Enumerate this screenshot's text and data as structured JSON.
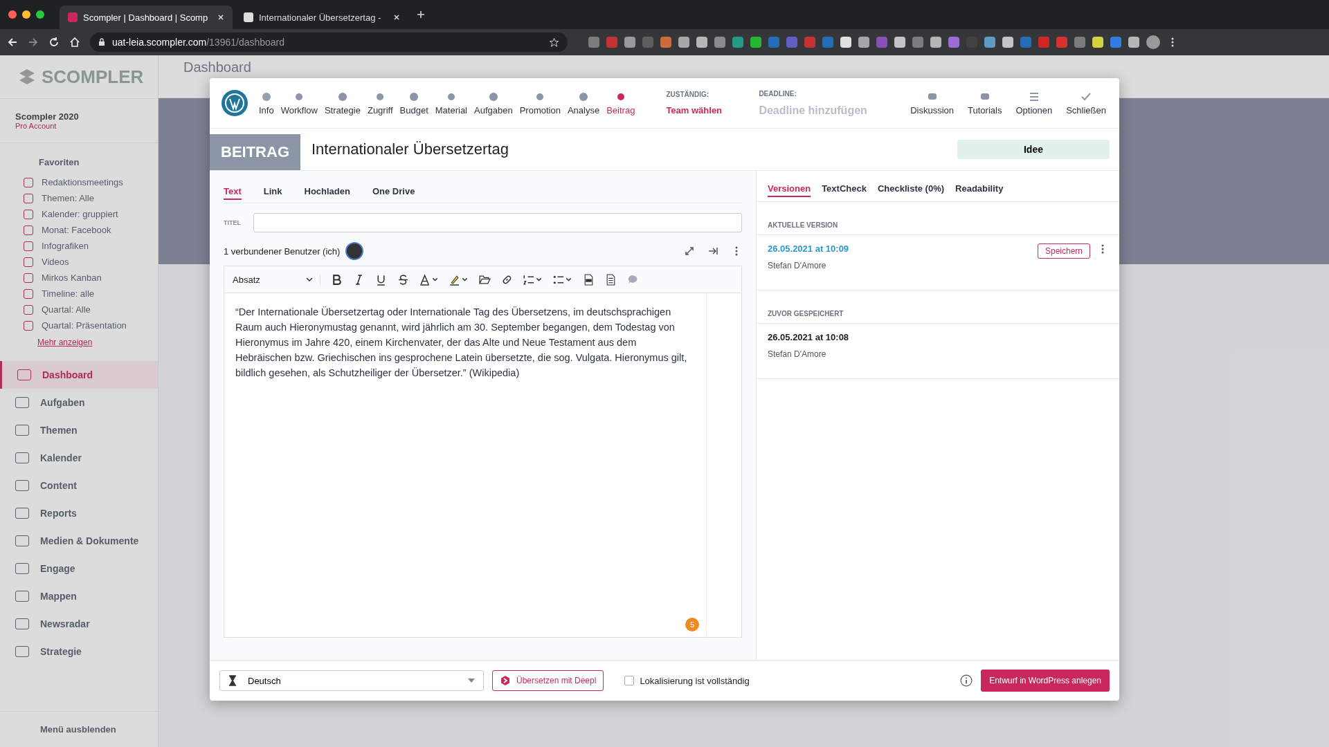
{
  "browser": {
    "tabs": [
      {
        "title": "Scompler | Dashboard | Scomp",
        "selected": true
      },
      {
        "title": "Internationaler Übersetzertag -",
        "selected": false
      }
    ],
    "url_host": "uat-leia.scompler.com",
    "url_path": "/13961/dashboard"
  },
  "background": {
    "logo": "SCOMPLER",
    "header": "Dashboard",
    "workspace": "Scompler 2020",
    "plan": "Pro Account",
    "favorites_label": "Favoriten",
    "favorites": [
      "Redaktionsmeetings",
      "Themen: Alle",
      "Kalender: gruppiert",
      "Monat: Facebook",
      "Infografiken",
      "Videos",
      "Mirkos Kanban",
      "Timeline: alle",
      "Quartal: Alle",
      "Quartal: Präsentation"
    ],
    "more_link": "Mehr anzeigen",
    "nav": [
      {
        "label": "Dashboard",
        "selected": true
      },
      {
        "label": "Aufgaben",
        "selected": false
      },
      {
        "label": "Themen",
        "selected": false
      },
      {
        "label": "Kalender",
        "selected": false
      },
      {
        "label": "Content",
        "selected": false
      },
      {
        "label": "Reports",
        "selected": false
      },
      {
        "label": "Medien & Dokumente",
        "selected": false
      },
      {
        "label": "Engage",
        "selected": false
      },
      {
        "label": "Mappen",
        "selected": false
      },
      {
        "label": "Newsradar",
        "selected": false
      },
      {
        "label": "Strategie",
        "selected": false
      }
    ],
    "hide_menu": "Menü ausblenden"
  },
  "modal": {
    "nav": [
      {
        "label": "Info",
        "selected": false
      },
      {
        "label": "Workflow",
        "selected": false
      },
      {
        "label": "Strategie",
        "selected": false
      },
      {
        "label": "Zugriff",
        "selected": false
      },
      {
        "label": "Budget",
        "selected": false
      },
      {
        "label": "Material",
        "selected": false
      },
      {
        "label": "Aufgaben",
        "selected": false
      },
      {
        "label": "Promotion",
        "selected": false
      },
      {
        "label": "Analyse",
        "selected": false
      },
      {
        "label": "Beitrag",
        "selected": true
      }
    ],
    "assignee": {
      "label": "ZUSTÄNDIG:",
      "value": "Team wählen"
    },
    "deadline": {
      "label": "DEADLINE:",
      "placeholder": "Deadline hinzufügen"
    },
    "actions": [
      "Diskussion",
      "Tutorials",
      "Optionen",
      "Schließen"
    ],
    "type_badge": "BEITRAG",
    "title": "Internationaler Übersetzertag",
    "status": "Idee",
    "editor_tabs": [
      {
        "label": "Text",
        "selected": true
      },
      {
        "label": "Link",
        "selected": false
      },
      {
        "label": "Hochladen",
        "selected": false
      },
      {
        "label": "One Drive",
        "selected": false
      }
    ],
    "title_field": {
      "label": "TITEL"
    },
    "users_label": "1 verbundener Benutzer (ich)",
    "format_select": "Absatz",
    "body": "“Der Internationale Übersetzertag oder Internationale Tag des Übersetzens, im deutschsprachigen Raum auch Hieronymustag genannt, wird jährlich am 30. September begangen, dem Todestag von Hieronymus im Jahre 420, einem Kirchenvater, der das Alte und Neue Testament aus dem Hebräischen bzw. Griechischen ins gesprochene Latein übersetzte, die sog. Vulgata. Hieronymus gilt, bildlich gesehen, als Schutzheiliger der Übersetzer.” (Wikipedia)",
    "counter": "5",
    "side_tabs": [
      {
        "label": "Versionen",
        "selected": true
      },
      {
        "label": "TextCheck",
        "selected": false
      },
      {
        "label": "Checkliste (0%)",
        "selected": false
      },
      {
        "label": "Readability",
        "selected": false
      }
    ],
    "versions": [
      {
        "heading": "AKTUELLE VERSION",
        "date": "26.05.2021 at 10:09",
        "author": "Stefan D'Amore",
        "current": true,
        "button": "Speichern"
      },
      {
        "heading": "ZUVOR GESPEICHERT",
        "date": "26.05.2021 at 10:08",
        "author": "Stefan D'Amore",
        "current": false
      }
    ],
    "footer": {
      "language": "Deutsch",
      "translate_button": "Übersetzen mit Deepl",
      "localized": {
        "label": "Lokalisierung ist vollständig",
        "checked": false
      },
      "publish_button": "Entwurf in WordPress anlegen"
    }
  }
}
